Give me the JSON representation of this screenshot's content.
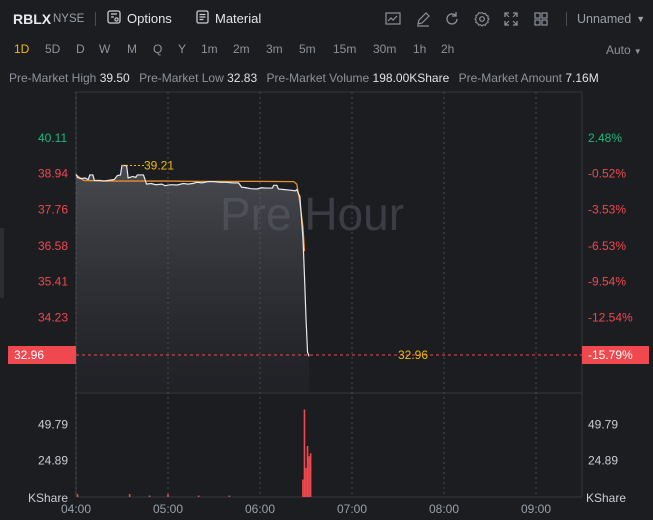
{
  "header": {
    "symbol": "RBLX",
    "exchange": "NYSE",
    "options_label": "Options",
    "material_label": "Material",
    "layout_name": "Unnamed",
    "tool_icons": [
      "indicator-icon",
      "draw-icon",
      "reset-icon",
      "settings-icon",
      "fullscreen-icon",
      "grid-layout-icon"
    ]
  },
  "timeframes": [
    "1D",
    "5D",
    "D",
    "W",
    "M",
    "Q",
    "Y",
    "1m",
    "2m",
    "3m",
    "5m",
    "15m",
    "30m",
    "1h",
    "2h"
  ],
  "active_timeframe": "1D",
  "scale_mode": "Auto",
  "stats": [
    {
      "label": "Pre-Market High",
      "value": "39.50"
    },
    {
      "label": "Pre-Market Low",
      "value": "32.83"
    },
    {
      "label": "Pre-Market Volume",
      "value": "198.00KShare"
    },
    {
      "label": "Pre-Market Amount",
      "value": "7.16M"
    }
  ],
  "chart_data": {
    "type": "line",
    "watermark": "Pre Hour",
    "price_ticks": [
      {
        "price": "40.11",
        "pct": "2.48%"
      },
      {
        "price": "38.94",
        "pct": "-0.52%"
      },
      {
        "price": "37.76",
        "pct": "-3.53%"
      },
      {
        "price": "36.58",
        "pct": "-6.53%"
      },
      {
        "price": "35.41",
        "pct": "-9.54%"
      },
      {
        "price": "34.23",
        "pct": "-12.54%"
      }
    ],
    "ylim": [
      32.83,
      40.11
    ],
    "last_price": "32.96",
    "last_pct": "-15.79%",
    "high_marker": "39.21",
    "volume_ticks": [
      "49.79",
      "24.89"
    ],
    "volume_unit": "KShare",
    "time_labels": [
      "04:00",
      "05:00",
      "06:00",
      "07:00",
      "08:00",
      "09:00"
    ],
    "price_series": [
      [
        0,
        38.92
      ],
      [
        1,
        38.82
      ],
      [
        3,
        38.78
      ],
      [
        6,
        38.8
      ],
      [
        8,
        38.75
      ],
      [
        9,
        38.9
      ],
      [
        11,
        38.9
      ],
      [
        12,
        38.72
      ],
      [
        16,
        38.72
      ],
      [
        18,
        38.7
      ],
      [
        25,
        38.75
      ],
      [
        27,
        38.88
      ],
      [
        29,
        38.9
      ],
      [
        30,
        39.21
      ],
      [
        33,
        39.21
      ],
      [
        34,
        38.8
      ],
      [
        37,
        38.85
      ],
      [
        39,
        38.82
      ],
      [
        40,
        38.9
      ],
      [
        44,
        38.9
      ],
      [
        46,
        38.6
      ],
      [
        49,
        38.62
      ],
      [
        52,
        38.58
      ],
      [
        56,
        38.6
      ],
      [
        58,
        38.55
      ],
      [
        62,
        38.58
      ],
      [
        66,
        38.57
      ],
      [
        70,
        38.62
      ],
      [
        73,
        38.6
      ],
      [
        76,
        38.62
      ],
      [
        79,
        38.66
      ],
      [
        82,
        38.64
      ],
      [
        86,
        38.68
      ],
      [
        90,
        38.68
      ],
      [
        94,
        38.66
      ],
      [
        98,
        38.66
      ],
      [
        102,
        38.64
      ],
      [
        106,
        38.64
      ],
      [
        108,
        38.5
      ],
      [
        111,
        38.48
      ],
      [
        114,
        38.45
      ],
      [
        118,
        38.44
      ],
      [
        121,
        38.48
      ],
      [
        124,
        38.47
      ],
      [
        128,
        38.47
      ],
      [
        129,
        38.56
      ],
      [
        131,
        38.56
      ],
      [
        132,
        38.44
      ],
      [
        136,
        38.42
      ],
      [
        140,
        38.4
      ],
      [
        143,
        38.38
      ],
      [
        144,
        38.42
      ],
      [
        145,
        38.3
      ],
      [
        146,
        38.2
      ],
      [
        148,
        36.85
      ],
      [
        149,
        35.6
      ],
      [
        150,
        34.2
      ],
      [
        151,
        33.1
      ],
      [
        152,
        32.96
      ]
    ],
    "avg_series": [
      [
        0,
        38.9
      ],
      [
        5,
        38.72
      ],
      [
        20,
        38.7
      ],
      [
        40,
        38.7
      ],
      [
        60,
        38.7
      ],
      [
        80,
        38.69
      ],
      [
        100,
        38.69
      ],
      [
        120,
        38.69
      ],
      [
        142,
        38.68
      ],
      [
        144,
        38.6
      ],
      [
        146,
        38.0
      ],
      [
        148,
        37.2
      ],
      [
        149,
        36.4
      ]
    ],
    "volume_bars": [
      [
        1,
        2
      ],
      [
        35,
        2
      ],
      [
        48,
        1
      ],
      [
        60,
        2
      ],
      [
        80,
        1
      ],
      [
        100,
        1
      ],
      [
        148,
        12
      ],
      [
        149,
        60
      ],
      [
        150,
        20
      ],
      [
        151,
        35
      ],
      [
        152,
        28
      ],
      [
        153,
        30
      ]
    ]
  },
  "colors": {
    "background": "#1c1d21",
    "up": "#1fb87a",
    "down": "#f0484f",
    "accent": "#f0b90b",
    "avg_line": "#e88e2b"
  }
}
